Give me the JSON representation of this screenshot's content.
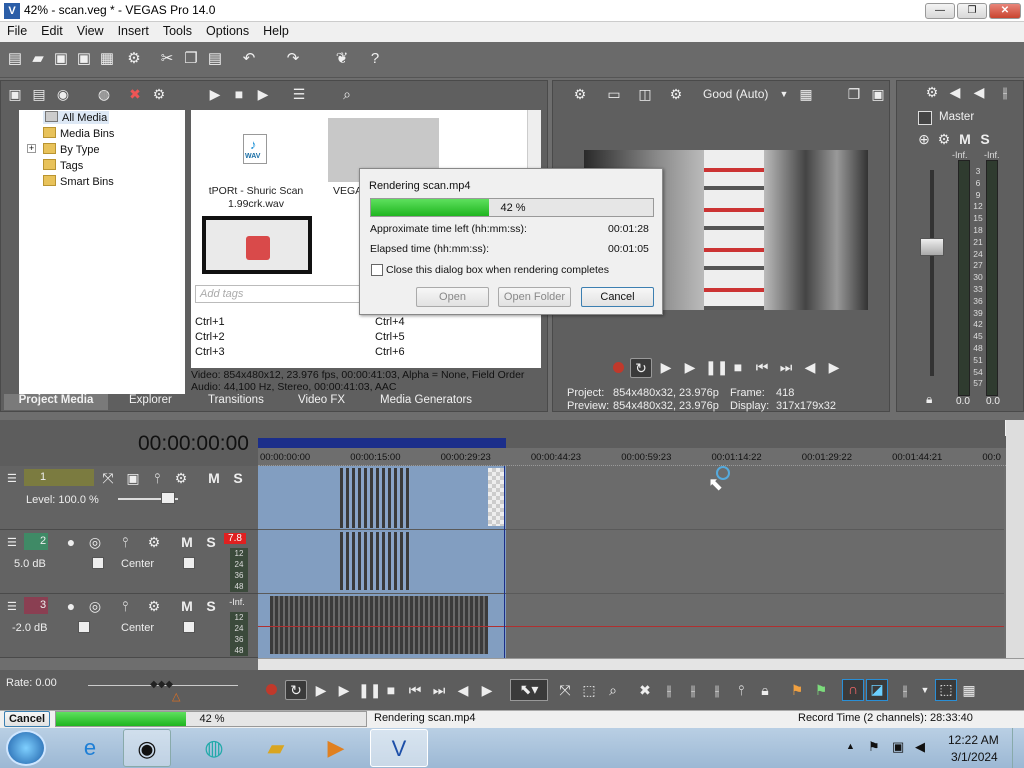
{
  "window": {
    "title": "42% - scan.veg * - VEGAS Pro 14.0",
    "min_label": "—",
    "max_label": "❐",
    "close_label": "✕"
  },
  "menu": [
    "File",
    "Edit",
    "View",
    "Insert",
    "Tools",
    "Options",
    "Help"
  ],
  "explorer_tree": {
    "all_media": "All Media",
    "media_bins": "Media Bins",
    "by_type": "By Type",
    "tags": "Tags",
    "smart_bins": "Smart Bins"
  },
  "media": {
    "wav_badge": "WAV",
    "file1_line1": "tPORt - Shuric Scan",
    "file1_line2": "1.99crk.wav",
    "file2_name": "VEGA",
    "tags_placeholder": "Add tags",
    "shortcuts_left": [
      "Ctrl+1",
      "Ctrl+2",
      "Ctrl+3"
    ],
    "shortcuts_right": [
      "Ctrl+4",
      "Ctrl+5",
      "Ctrl+6"
    ],
    "info_video": "Video: 854x480x12, 23.976 fps, 00:00:41:03, Alpha = None, Field Order",
    "info_audio": "Audio: 44,100 Hz, Stereo, 00:00:41:03, AAC"
  },
  "tabs": [
    "Project Media",
    "Explorer",
    "Transitions",
    "Video FX",
    "Media Generators"
  ],
  "render_dialog": {
    "title": "Rendering scan.mp4",
    "progress_label": "42 %",
    "progress": 0.42,
    "time_left_label": "Approximate time left (hh:mm:ss):",
    "time_left": "00:01:28",
    "elapsed_label": "Elapsed time (hh:mm:ss):",
    "elapsed": "00:01:05",
    "close_checkbox_label": "Close this dialog box when rendering completes",
    "open_button": "Open",
    "open_folder_button": "Open Folder",
    "cancel_button": "Cancel"
  },
  "preview": {
    "quality": "Good (Auto)",
    "project_label": "Project:",
    "project_value": "854x480x32, 23.976p",
    "preview_label": "Preview:",
    "preview_value": "854x480x32, 23.976p",
    "frame_label": "Frame:",
    "frame_value": "418",
    "display_label": "Display:",
    "display_value": "317x179x32"
  },
  "mixer": {
    "master_label": "Master",
    "inf_left": "-Inf.",
    "inf_right": "-Inf.",
    "scale": [
      "3",
      "6",
      "9",
      "12",
      "15",
      "18",
      "21",
      "24",
      "27",
      "30",
      "33",
      "36",
      "39",
      "42",
      "45",
      "48",
      "51",
      "54",
      "57"
    ],
    "bottom_left": "0.0",
    "bottom_right": "0.0"
  },
  "timeline": {
    "timecode": "00:00:00:00",
    "ruler": [
      "00:00:00:00",
      "00:00:15:00",
      "00:00:29:23",
      "00:00:44:23",
      "00:00:59:23",
      "00:01:14:22",
      "00:01:29:22",
      "00:01:44:21",
      "00:0"
    ],
    "tracks": [
      {
        "num": "1",
        "level": "Level: 100.0 %",
        "color": "#6b6b2e"
      },
      {
        "num": "2",
        "volume": "5.0 dB",
        "pan": "Center",
        "peak": "7.8",
        "color": "#2e6b4e"
      },
      {
        "num": "3",
        "volume": "-2.0 dB",
        "pan": "Center",
        "peak": "-Inf.",
        "color": "#6b2e3e"
      }
    ],
    "track_meter_scale": [
      "12",
      "24",
      "36",
      "48"
    ],
    "rate": "Rate: 0.00"
  },
  "statusbar": {
    "cancel": "Cancel",
    "progress_label": "42 %",
    "progress": 0.42,
    "rendering": "Rendering scan.mp4",
    "record_time": "Record Time (2 channels): 28:33:40"
  },
  "taskbar": {
    "time": "12:22 AM",
    "date": "3/1/2024"
  }
}
